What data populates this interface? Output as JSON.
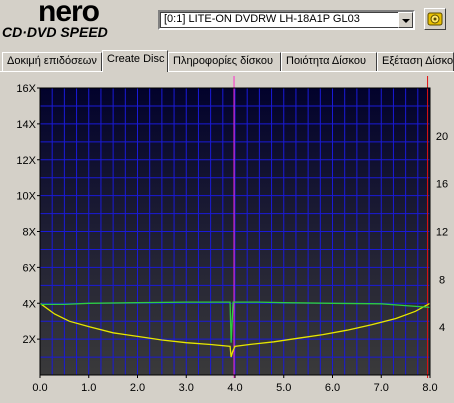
{
  "logo": {
    "word": "nero",
    "subtitle": "CD·DVD SPEED"
  },
  "drive": {
    "selected": "[0:1]   LITE-ON DVDRW LH-18A1P GL03"
  },
  "tabs": [
    {
      "label": "Δοκιμή επιδόσεων",
      "active": false
    },
    {
      "label": "Create Disc",
      "active": true
    },
    {
      "label": "Πληροφορίες δίσκου",
      "active": false
    },
    {
      "label": "Ποιότητα Δίσκου",
      "active": false
    },
    {
      "label": "Εξέταση Δίσκου",
      "active": false
    }
  ],
  "icons": {
    "drive_dropdown": "chevron-down-icon",
    "toolbar": "settings-icon"
  },
  "colors": {
    "plot_bg_top": "#02022c",
    "plot_bg_bottom": "#3a3a3a",
    "grid": "#1a1ad8",
    "write_speed": "#e6e600",
    "rpm": "#2ecc40",
    "marker_layer": "#ff2ecc",
    "marker_end": "#e01010"
  },
  "chart_data": {
    "type": "line",
    "x_ticks": [
      "0.0",
      "1.0",
      "2.0",
      "3.0",
      "4.0",
      "5.0",
      "6.0",
      "7.0",
      "8.0"
    ],
    "xlim": [
      0,
      8.0
    ],
    "y_left_ticks": [
      "2X",
      "4X",
      "6X",
      "8X",
      "10X",
      "12X",
      "14X",
      "16X"
    ],
    "y_left_lim": [
      0,
      16
    ],
    "y_right_ticks": [
      "4",
      "8",
      "12",
      "16",
      "20"
    ],
    "y_right_lim": [
      0,
      24
    ],
    "grid": true,
    "vertical_markers": [
      {
        "x": 3.98
      },
      {
        "x": 7.95
      }
    ],
    "series": [
      {
        "axis": "left",
        "x": [
          0.0,
          0.3,
          0.6,
          1.0,
          1.5,
          2.0,
          2.5,
          3.0,
          3.5,
          3.9,
          3.92,
          3.95,
          4.0,
          4.3,
          4.8,
          5.3,
          5.8,
          6.3,
          6.8,
          7.3,
          7.7,
          8.0
        ],
        "values": [
          4.0,
          3.4,
          3.0,
          2.7,
          2.35,
          2.15,
          1.95,
          1.8,
          1.7,
          1.6,
          1.0,
          1.3,
          1.6,
          1.7,
          1.85,
          2.05,
          2.25,
          2.5,
          2.8,
          3.15,
          3.55,
          4.0
        ]
      },
      {
        "axis": "right",
        "x": [
          0.0,
          0.5,
          1.0,
          2.0,
          3.0,
          3.9,
          3.92,
          3.96,
          4.0,
          4.5,
          5.0,
          6.0,
          7.0,
          7.5,
          8.0
        ],
        "values": [
          5.9,
          5.9,
          6.0,
          6.05,
          6.1,
          6.1,
          2.7,
          6.1,
          6.1,
          6.1,
          6.05,
          6.0,
          5.95,
          5.8,
          5.65
        ]
      }
    ]
  }
}
